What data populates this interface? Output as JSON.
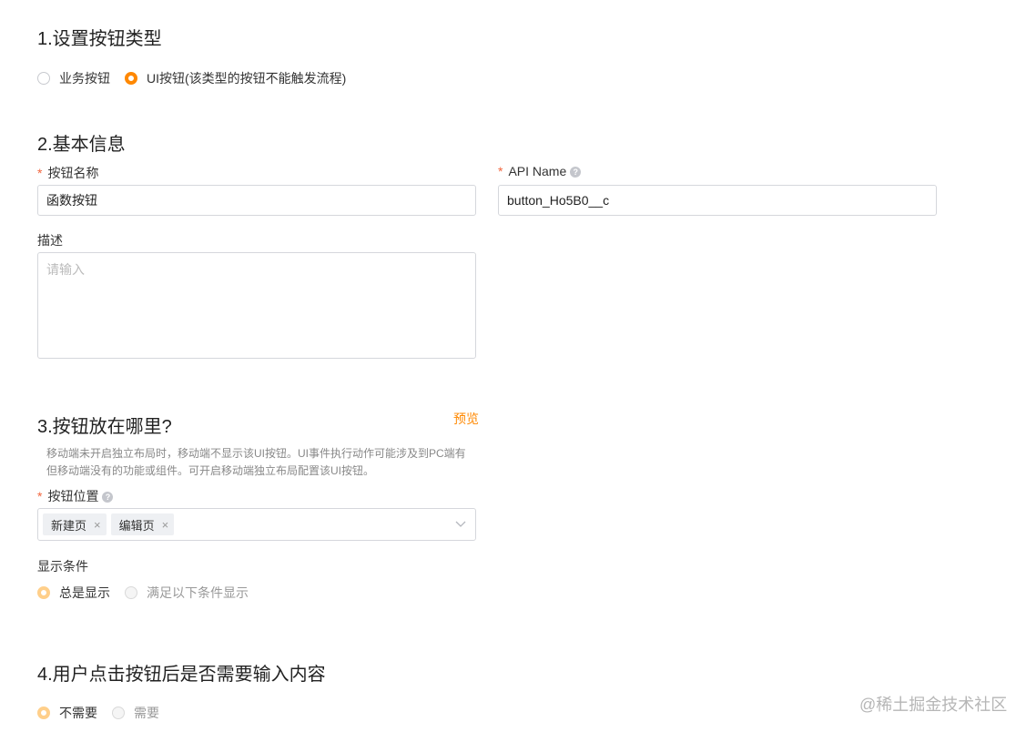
{
  "section1": {
    "title": "1.设置按钮类型",
    "options": [
      {
        "label": "业务按钮",
        "selected": false
      },
      {
        "label": "UI按钮(该类型的按钮不能触发流程)",
        "selected": true
      }
    ]
  },
  "section2": {
    "title": "2.基本信息",
    "name_label": "按钮名称",
    "name_value": "函数按钮",
    "api_label": "API Name",
    "api_value": "button_Ho5B0__c",
    "desc_label": "描述",
    "desc_placeholder": "请输入",
    "required_mark": "*",
    "help_icon": "?"
  },
  "section3": {
    "title": "3.按钮放在哪里?",
    "preview_label": "预览",
    "note_line1": "移动端未开启独立布局时，移动端不显示该UI按钮。UI事件执行动作可能涉及到PC端有",
    "note_line2": "但移动端没有的功能或组件。可开启移动端独立布局配置该UI按钮。",
    "position_label": "按钮位置",
    "position_tags": [
      "新建页",
      "编辑页"
    ],
    "tag_remove": "×",
    "condition_label": "显示条件",
    "condition_options": [
      {
        "label": "总是显示",
        "selected": true
      },
      {
        "label": "满足以下条件显示",
        "selected": false
      }
    ]
  },
  "section4": {
    "title": "4.用户点击按钮后是否需要输入内容",
    "options": [
      {
        "label": "不需要",
        "selected": true
      },
      {
        "label": "需要",
        "selected": false
      }
    ]
  },
  "watermark": "@稀土掘金技术社区",
  "colors": {
    "accent": "#ff8800",
    "required": "#f2663e"
  },
  "icons": {
    "help": "question-circle-icon",
    "chevron": "chevron-down-icon",
    "remove": "close-icon"
  }
}
